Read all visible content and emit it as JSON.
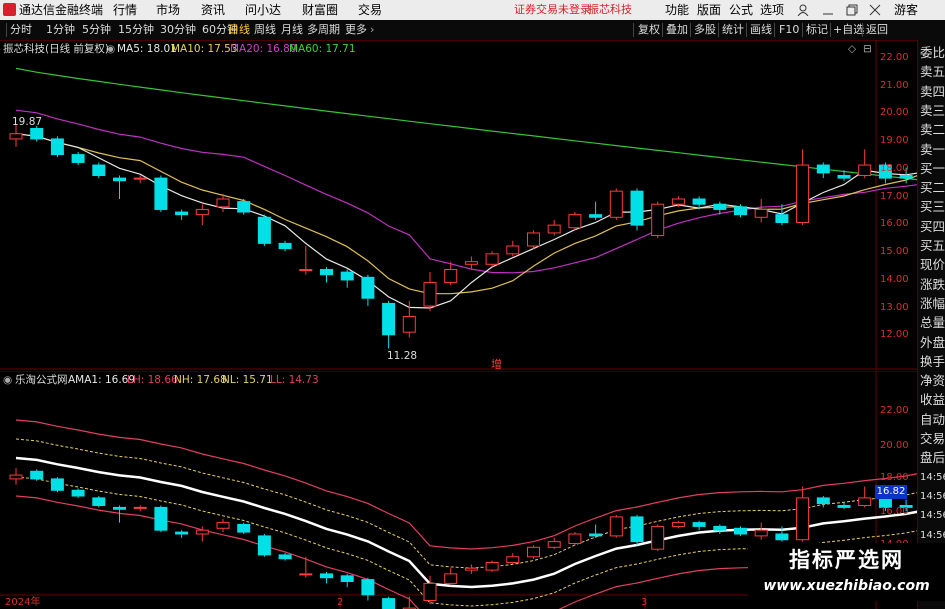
{
  "app": {
    "title": "通达信金融终端",
    "menu": [
      "行情",
      "市场",
      "资讯",
      "问小达",
      "财富圈",
      "交易"
    ],
    "login_status": "证券交易未登录",
    "stock_name": "振芯科技",
    "right_menu": [
      "功能",
      "版面",
      "公式",
      "选项"
    ],
    "guest": "游客",
    "colors": {
      "accent_red": "#d8202a",
      "up": "#ff3b3b",
      "down": "#00e0e6"
    }
  },
  "toolbar": {
    "periods": [
      "分时",
      "1分钟",
      "5分钟",
      "15分钟",
      "30分钟",
      "60分钟",
      "日线",
      "周线",
      "月线",
      "多周期",
      "更多"
    ],
    "active_period": "日线",
    "tools": [
      "复权",
      "叠加",
      "多股",
      "统计",
      "画线",
      "F10",
      "标记",
      "+自选",
      "返回"
    ]
  },
  "main_chart": {
    "legend_title": "振芯科技(日线 前复权)",
    "ma5": "MA5: 18.01",
    "ma10": "MA10: 17.53",
    "ma20": "MA20: 16.80",
    "ma60": "MA60: 17.71",
    "high_marker": "19.87",
    "low_marker": "11.28",
    "badge": "增",
    "y_ticks": [
      "22.00",
      "21.00",
      "20.00",
      "19.00",
      "18.00",
      "17.00",
      "16.00",
      "15.00",
      "14.00",
      "13.00",
      "12.00"
    ]
  },
  "sub_chart": {
    "legend_title": "乐淘公式网",
    "ama1": "AMA1: 16.69",
    "lh": "LH: 18.66",
    "nh": "NH: 17.68",
    "nl": "NL: 15.71",
    "ll": "LL: 14.73",
    "y_ticks": [
      "22.00",
      "20.00",
      "18.00",
      "16.00",
      "14.00"
    ],
    "current_price": "16.82"
  },
  "dates": [
    "2024年",
    "2",
    "3"
  ],
  "sidebar": {
    "top_icons": [
      "B",
      "S"
    ],
    "items": [
      "委比",
      "卖五",
      "卖四",
      "卖三",
      "卖二",
      "卖一",
      "买一",
      "买二",
      "买三",
      "买四",
      "买五",
      "现价",
      "涨跌",
      "涨幅",
      "总量",
      "外盘",
      "换手",
      "净资",
      "收益",
      "自动",
      "交易",
      "盘后",
      "14:56",
      "14:56",
      "14:56",
      "14:56",
      "14:56",
      "14:56",
      "14:56"
    ]
  },
  "watermark": {
    "title": "指标严选网",
    "url": "www.xuezhibiao.com"
  },
  "chart_data": {
    "type": "candlestick",
    "title": "振芯科技(日线 前复权)",
    "candles": [
      {
        "o": 19.3,
        "c": 19.5,
        "h": 19.87,
        "l": 19.0
      },
      {
        "o": 19.7,
        "c": 19.3,
        "h": 19.8,
        "l": 19.2
      },
      {
        "o": 19.3,
        "c": 18.7,
        "h": 19.4,
        "l": 18.6
      },
      {
        "o": 18.7,
        "c": 18.4,
        "h": 18.8,
        "l": 18.3
      },
      {
        "o": 18.3,
        "c": 17.9,
        "h": 18.4,
        "l": 17.8
      },
      {
        "o": 17.8,
        "c": 17.7,
        "h": 17.9,
        "l": 17.0
      },
      {
        "o": 17.8,
        "c": 17.8,
        "h": 17.9,
        "l": 17.6
      },
      {
        "o": 17.8,
        "c": 16.6,
        "h": 17.9,
        "l": 16.5
      },
      {
        "o": 16.5,
        "c": 16.4,
        "h": 16.6,
        "l": 16.2
      },
      {
        "o": 16.4,
        "c": 16.6,
        "h": 16.8,
        "l": 16.0
      },
      {
        "o": 16.7,
        "c": 17.0,
        "h": 17.2,
        "l": 16.5
      },
      {
        "o": 16.9,
        "c": 16.5,
        "h": 17.0,
        "l": 16.4
      },
      {
        "o": 16.3,
        "c": 15.3,
        "h": 16.4,
        "l": 15.2
      },
      {
        "o": 15.3,
        "c": 15.1,
        "h": 15.4,
        "l": 15.0
      },
      {
        "o": 14.3,
        "c": 14.3,
        "h": 15.2,
        "l": 14.1
      },
      {
        "o": 14.3,
        "c": 14.1,
        "h": 14.4,
        "l": 13.8
      },
      {
        "o": 14.2,
        "c": 13.9,
        "h": 14.3,
        "l": 13.6
      },
      {
        "o": 14.0,
        "c": 13.2,
        "h": 14.1,
        "l": 12.9
      },
      {
        "o": 13.0,
        "c": 11.8,
        "h": 13.1,
        "l": 11.28
      },
      {
        "o": 11.9,
        "c": 12.5,
        "h": 13.1,
        "l": 11.7
      },
      {
        "o": 12.9,
        "c": 13.8,
        "h": 14.2,
        "l": 12.7
      },
      {
        "o": 13.8,
        "c": 14.3,
        "h": 14.6,
        "l": 13.7
      },
      {
        "o": 14.5,
        "c": 14.6,
        "h": 14.8,
        "l": 14.3
      },
      {
        "o": 14.5,
        "c": 14.9,
        "h": 15.0,
        "l": 14.4
      },
      {
        "o": 14.9,
        "c": 15.2,
        "h": 15.4,
        "l": 14.8
      },
      {
        "o": 15.2,
        "c": 15.7,
        "h": 15.8,
        "l": 15.1
      },
      {
        "o": 15.7,
        "c": 16.0,
        "h": 16.2,
        "l": 15.6
      },
      {
        "o": 15.9,
        "c": 16.4,
        "h": 16.5,
        "l": 15.8
      },
      {
        "o": 16.4,
        "c": 16.3,
        "h": 16.9,
        "l": 16.2
      },
      {
        "o": 16.3,
        "c": 17.3,
        "h": 17.4,
        "l": 16.2
      },
      {
        "o": 17.3,
        "c": 16.0,
        "h": 17.4,
        "l": 15.8
      },
      {
        "o": 15.6,
        "c": 16.8,
        "h": 16.9,
        "l": 15.5
      },
      {
        "o": 16.8,
        "c": 17.0,
        "h": 17.1,
        "l": 16.7
      },
      {
        "o": 17.0,
        "c": 16.8,
        "h": 17.1,
        "l": 16.6
      },
      {
        "o": 16.8,
        "c": 16.6,
        "h": 16.9,
        "l": 16.4
      },
      {
        "o": 16.7,
        "c": 16.4,
        "h": 16.8,
        "l": 16.3
      },
      {
        "o": 16.3,
        "c": 16.6,
        "h": 17.0,
        "l": 16.1
      },
      {
        "o": 16.4,
        "c": 16.1,
        "h": 16.8,
        "l": 16.0
      },
      {
        "o": 16.1,
        "c": 18.3,
        "h": 18.9,
        "l": 16.0
      },
      {
        "o": 18.3,
        "c": 18.0,
        "h": 18.4,
        "l": 17.8
      },
      {
        "o": 17.9,
        "c": 17.8,
        "h": 18.1,
        "l": 17.7
      },
      {
        "o": 17.9,
        "c": 18.3,
        "h": 18.9,
        "l": 17.8
      },
      {
        "o": 18.3,
        "c": 17.8,
        "h": 18.4,
        "l": 17.6
      },
      {
        "o": 17.9,
        "c": 17.8,
        "h": 18.2,
        "l": 17.6
      },
      {
        "o": 17.9,
        "c": 18.3,
        "h": 18.4,
        "l": 17.8
      }
    ],
    "y_range": [
      11.5,
      22.5
    ],
    "sub_y_range": [
      13.5,
      23.5
    ]
  }
}
